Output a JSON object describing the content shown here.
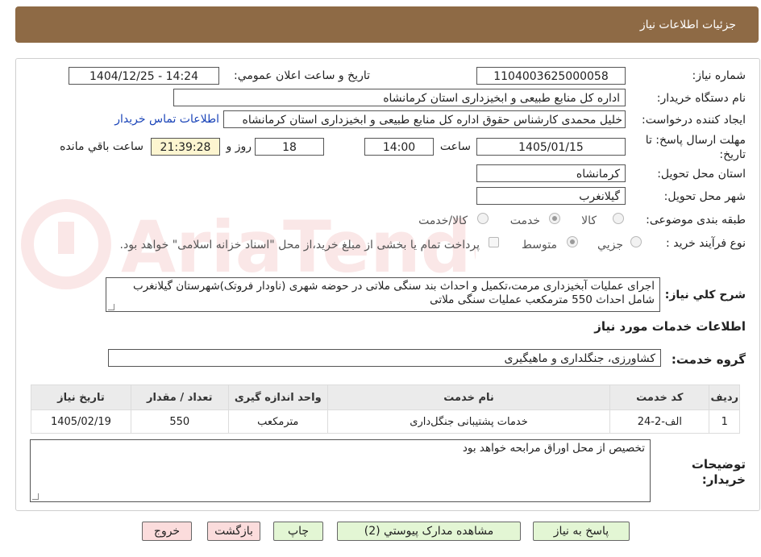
{
  "header": {
    "title": "جزئیات اطلاعات نیاز"
  },
  "labels": {
    "need_number": "شماره نیاز:",
    "announce_date": "تاریخ و ساعت اعلان عمومي:",
    "buyer_org": "نام دستگاه خریدار:",
    "requester": "ایجاد کننده درخواست:",
    "deadline_line1": "مهلت ارسال پاسخ: تا",
    "deadline_line2": "تاریخ:",
    "time_word": "ساعت",
    "days_and": "روز و",
    "remaining": "ساعت باقي مانده",
    "province": "استان محل تحویل:",
    "city": "شهر محل تحویل:",
    "category": "طبقه بندی موضوعی:",
    "process": "نوع فرآیند خرید :",
    "general_desc": "شرح کلي نیاز:",
    "services_info": "اطلاعات خدمات مورد نیاز",
    "service_group": "گروه خدمت:",
    "buyer_notes_line1": "توضیحات",
    "buyer_notes_line2": "خریدار:"
  },
  "fields": {
    "need_number": "1104003625000058",
    "announce_datetime": "1404/12/25 - 14:24",
    "buyer_org": "اداره کل منابع طبیعی و ابخیزداری استان کرمانشاه",
    "requester": "خلیل محمدی کارشناس حقوق اداره کل منابع طبیعی و ابخیزداری استان کرمانشاه",
    "contact_link": "اطلاعات تماس خریدار",
    "deadline_date": "1405/01/15",
    "deadline_time": "14:00",
    "days": "18",
    "remaining_time": "21:39:28",
    "province": "کرمانشاه",
    "city": "گیلانغرب",
    "service_group": "کشاورزی، جنگلداری و ماهیگیری",
    "general_desc": "اجرای عملیات آبخیزداری مرمت،تکمیل و احداث بند سنگی ملاتی در حوضه شهری (ناودار فروتک)شهرستان گیلانغرب شامل احداث 550 مترمکعب عملیات سنگی ملاتی",
    "buyer_notes": "تخصیص از محل اوراق مرابحه خواهد بود"
  },
  "category_options": [
    {
      "label": "کالا",
      "selected": false
    },
    {
      "label": "خدمت",
      "selected": true
    },
    {
      "label": "کالا/خدمت",
      "selected": false
    }
  ],
  "process_options": [
    {
      "label": "جزیي",
      "selected": false
    },
    {
      "label": "متوسط",
      "selected": true
    }
  ],
  "payment_note": "پرداخت تمام یا بخشی از مبلغ خرید،از محل \"اسناد خزانه اسلامی\" خواهد بود.",
  "table": {
    "headers": [
      "ردیف",
      "کد خدمت",
      "نام خدمت",
      "واحد اندازه گیری",
      "تعداد / مقدار",
      "تاریخ نیاز"
    ],
    "rows": [
      [
        "1",
        "الف-2-24",
        "خدمات پشتیبانی جنگل‌داری",
        "مترمکعب",
        "550",
        "1405/02/19"
      ]
    ]
  },
  "buttons": {
    "reply": "پاسخ به نیاز",
    "attachments": "مشاهده مدارک پیوستي (2)",
    "print": "چاپ",
    "back": "بازگشت",
    "exit": "خروج"
  },
  "watermark": "AriaTender.neT",
  "colors": {
    "header": "#8e6a45",
    "link": "#1a44b8",
    "remaining_bg": "#fdf5d0",
    "button_green": "#e3f6d4",
    "button_pink": "#fbdcdc"
  }
}
